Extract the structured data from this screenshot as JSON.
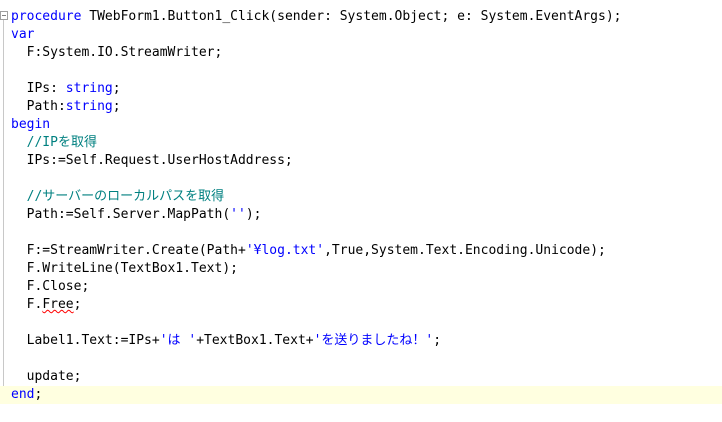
{
  "editor": {
    "lines": [
      [
        {
          "t": "procedure",
          "c": "kw"
        },
        {
          "t": " TWebForm1.Button1_Click(sender: System.Object; e: System.EventArgs);",
          "c": "id"
        }
      ],
      [
        {
          "t": "var",
          "c": "kw"
        }
      ],
      [
        {
          "t": "  F:System.IO.StreamWriter;",
          "c": "id"
        }
      ],
      [],
      [
        {
          "t": "  IPs: ",
          "c": "id"
        },
        {
          "t": "string",
          "c": "kw"
        },
        {
          "t": ";",
          "c": "id"
        }
      ],
      [
        {
          "t": "  Path:",
          "c": "id"
        },
        {
          "t": "string",
          "c": "kw"
        },
        {
          "t": ";",
          "c": "id"
        }
      ],
      [
        {
          "t": "begin",
          "c": "kw"
        }
      ],
      [
        {
          "t": "  //IPを取得",
          "c": "cm"
        }
      ],
      [
        {
          "t": "  IPs:=Self.Request.UserHostAddress;",
          "c": "id"
        }
      ],
      [],
      [
        {
          "t": "  //サーバーのローカルパスを取得",
          "c": "cm"
        }
      ],
      [
        {
          "t": "  Path:=Self.Server.MapPath(",
          "c": "id"
        },
        {
          "t": "''",
          "c": "str"
        },
        {
          "t": ");",
          "c": "id"
        }
      ],
      [],
      [
        {
          "t": "  F:=StreamWriter.Create(Path+",
          "c": "id"
        },
        {
          "t": "'¥log.txt'",
          "c": "str"
        },
        {
          "t": ",True,System.Text.Encoding.Unicode);",
          "c": "id"
        }
      ],
      [
        {
          "t": "  F.WriteLine(TextBox1.Text);",
          "c": "id"
        }
      ],
      [
        {
          "t": "  F.Close;",
          "c": "id"
        }
      ],
      [
        {
          "t": "  F.",
          "c": "id"
        },
        {
          "t": "Free",
          "c": "id",
          "u": true
        },
        {
          "t": ";",
          "c": "id"
        }
      ],
      [],
      [
        {
          "t": "  Label1.Text:=IPs+",
          "c": "id"
        },
        {
          "t": "'は '",
          "c": "str"
        },
        {
          "t": "+TextBox1.Text+",
          "c": "id"
        },
        {
          "t": "'を送りましたね！'",
          "c": "str"
        },
        {
          "t": ";",
          "c": "id"
        }
      ],
      [],
      [
        {
          "t": "  update;",
          "c": "id"
        }
      ],
      [
        {
          "t": "end",
          "c": "kw"
        },
        {
          "t": ";",
          "c": "id"
        }
      ]
    ],
    "current_line": 21
  },
  "colors": {
    "keyword": "#0000ff",
    "comment": "#008080",
    "string": "#0000ff",
    "current_line_bg": "#ffffe0"
  }
}
